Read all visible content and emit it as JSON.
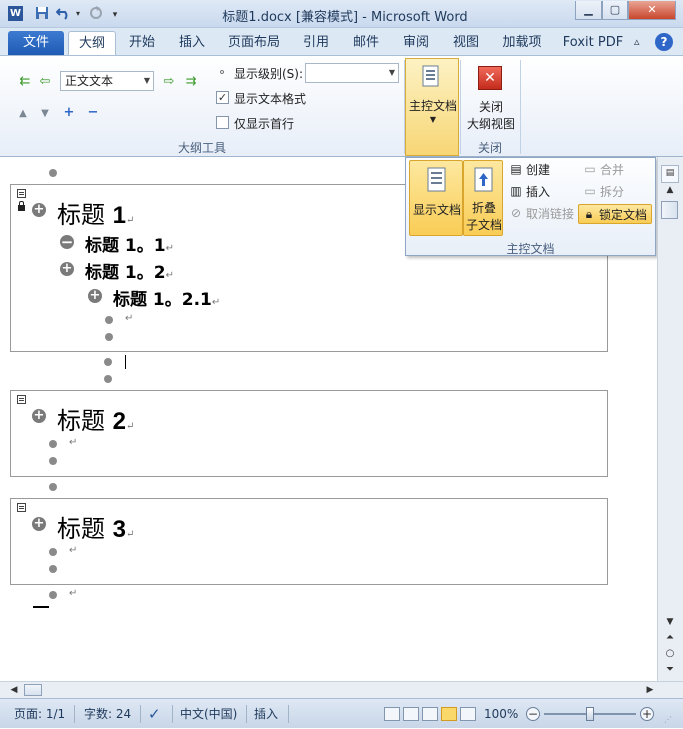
{
  "window": {
    "title": "标题1.docx [兼容模式] - Microsoft Word",
    "app_icon": "W"
  },
  "qat": {
    "save_icon": "save-icon",
    "undo_icon": "undo-icon",
    "redo_icon": "redo-icon"
  },
  "tabs": [
    {
      "label": "文件"
    },
    {
      "label": "大纲"
    },
    {
      "label": "开始"
    },
    {
      "label": "插入"
    },
    {
      "label": "页面布局"
    },
    {
      "label": "引用"
    },
    {
      "label": "邮件"
    },
    {
      "label": "审阅"
    },
    {
      "label": "视图"
    },
    {
      "label": "加载项"
    },
    {
      "label": "Foxit PDF"
    }
  ],
  "outline_tools": {
    "group_label": "大纲工具",
    "level_value": "正文文本",
    "show_level_label": "显示级别(S):",
    "show_level_value": "",
    "show_text_format_label": "显示文本格式",
    "show_text_format_checked": true,
    "show_first_line_label": "仅显示首行",
    "show_first_line_checked": false
  },
  "master_doc": {
    "button_label": "主控文档",
    "group_label": "主控文档",
    "show_doc": "显示文档",
    "collapse_sub_line1": "折叠",
    "collapse_sub_line2": "子文档",
    "create": "创建",
    "insert": "插入",
    "unlink": "取消链接",
    "merge": "合并",
    "split": "拆分",
    "lock": "锁定文档"
  },
  "close_group": {
    "button_line1": "关闭",
    "button_line2": "大纲视图",
    "group_label": "关闭"
  },
  "document": {
    "h1_1": {
      "text": "标题 ",
      "num": "1"
    },
    "h2_1": "标题 1。1",
    "h2_2": "标题 1。2",
    "h3_1": "标题 1。2.1",
    "h1_2": {
      "text": "标题 ",
      "num": "2"
    },
    "h1_3": {
      "text": "标题 ",
      "num": "3"
    },
    "para_mark": "↵"
  },
  "status": {
    "page": "页面: 1/1",
    "words": "字数: 24",
    "language": "中文(中国)",
    "mode": "插入",
    "zoom": "100%"
  }
}
